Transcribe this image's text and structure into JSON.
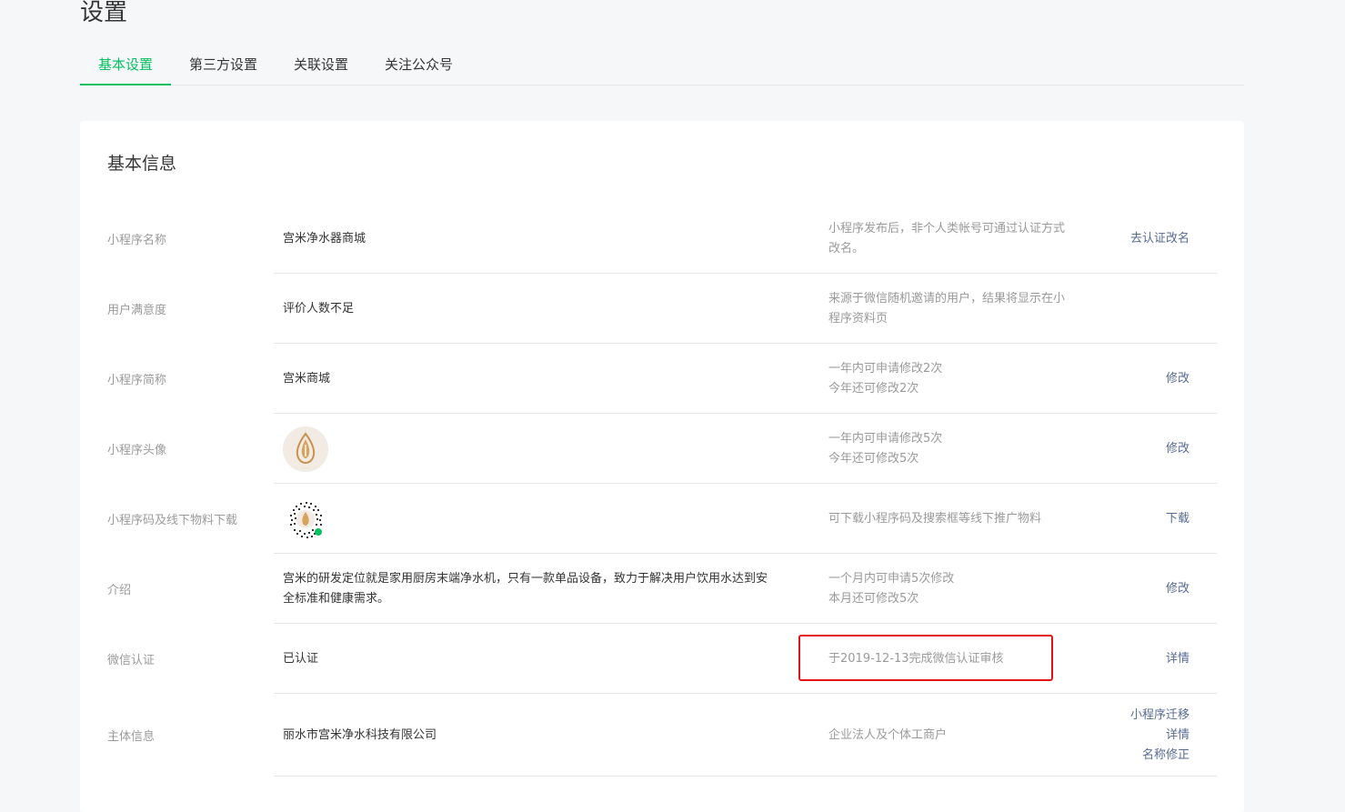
{
  "page": {
    "title": "设置"
  },
  "tabs": [
    {
      "label": "基本设置",
      "active": true
    },
    {
      "label": "第三方设置",
      "active": false
    },
    {
      "label": "关联设置",
      "active": false
    },
    {
      "label": "关注公众号",
      "active": false
    }
  ],
  "card": {
    "title": "基本信息"
  },
  "rows": {
    "name": {
      "label": "小程序名称",
      "value": "宫米净水器商城",
      "tip_line1": "小程序发布后，非个人类帐号可通过认证方式",
      "tip_line2": "改名。",
      "action": "去认证改名"
    },
    "satisfaction": {
      "label": "用户满意度",
      "value": "评价人数不足",
      "tip_line1": "来源于微信随机邀请的用户，结果将显示在小",
      "tip_line2": "程序资料页"
    },
    "short_name": {
      "label": "小程序简称",
      "value": "宫米商城",
      "tip_line1": "一年内可申请修改2次",
      "tip_line2": "今年还可修改2次",
      "action": "修改"
    },
    "avatar": {
      "label": "小程序头像",
      "tip_line1": "一年内可申请修改5次",
      "tip_line2": "今年还可修改5次",
      "action": "修改"
    },
    "code": {
      "label": "小程序码及线下物料下载",
      "tip_line1": "可下载小程序码及搜索框等线下推广物料",
      "action": "下载"
    },
    "intro": {
      "label": "介绍",
      "value_line1": "宫米的研发定位就是家用厨房末端净水机，只有一款单品设备，致力于解决用户饮用水达到安",
      "value_line2": "全标准和健康需求。",
      "tip_line1": "一个月内可申请5次修改",
      "tip_line2": "本月还可修改5次",
      "action": "修改"
    },
    "wechat_cert": {
      "label": "微信认证",
      "value": "已认证",
      "tip_line1": "于2019-12-13完成微信认证审核",
      "action": "详情"
    },
    "entity": {
      "label": "主体信息",
      "value": "丽水市宫米净水科技有限公司",
      "tip_line1": "企业法人及个体工商户",
      "action1": "小程序迁移",
      "action2": "详情",
      "action3": "名称修正"
    }
  },
  "colors": {
    "accent": "#07c160",
    "link": "#576b95",
    "highlight": "#e2141a"
  },
  "icons": {
    "avatar": "water-drop-logo",
    "qrcode": "mini-program-code"
  }
}
